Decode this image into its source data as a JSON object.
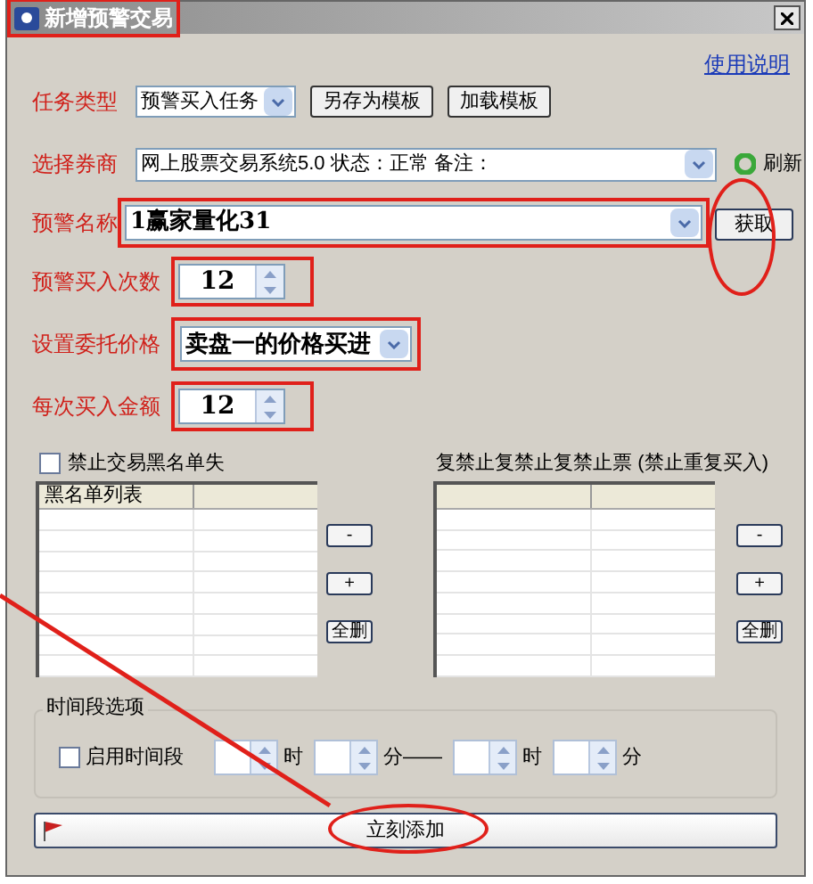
{
  "window": {
    "title": "新增预警交易",
    "highlighted": true
  },
  "help_link": "使用说明",
  "task_type": {
    "label": "任务类型",
    "value": "预警买入任务",
    "buttons": [
      "另存为模板",
      "加载模板"
    ]
  },
  "broker": {
    "label": "选择券商",
    "value": "网上股票交易系统5.0 状态：正常 备注：",
    "refresh": "刷新"
  },
  "alert_name": {
    "label": "预警名称",
    "value": "1赢家量化31",
    "highlighted": true,
    "fetch_button": "获取",
    "fetch_circled": true
  },
  "buy_count": {
    "label": "预警买入次数",
    "value": "12",
    "highlighted": true
  },
  "order_price": {
    "label": "设置委托价格",
    "value": "卖盘一的价格买进",
    "highlighted": true
  },
  "buy_amount": {
    "label": "每次买入金额",
    "value": "12",
    "highlighted": true
  },
  "blacklist": {
    "label": "禁止交易黑名单失",
    "checked": false,
    "column": "黑名单列表",
    "buttons": [
      "-",
      "+",
      "全删"
    ]
  },
  "repeat_list": {
    "label": "复禁止复禁止复禁止票 (禁止重复买入)",
    "buttons": [
      "-",
      "+",
      "全删"
    ]
  },
  "time_options": {
    "title": "时间段选项",
    "enable_label": "启用时间段",
    "checked": false,
    "units": [
      "时",
      "分——",
      "时",
      "分"
    ]
  },
  "add_button": {
    "label": "立刻添加",
    "circled": true
  }
}
